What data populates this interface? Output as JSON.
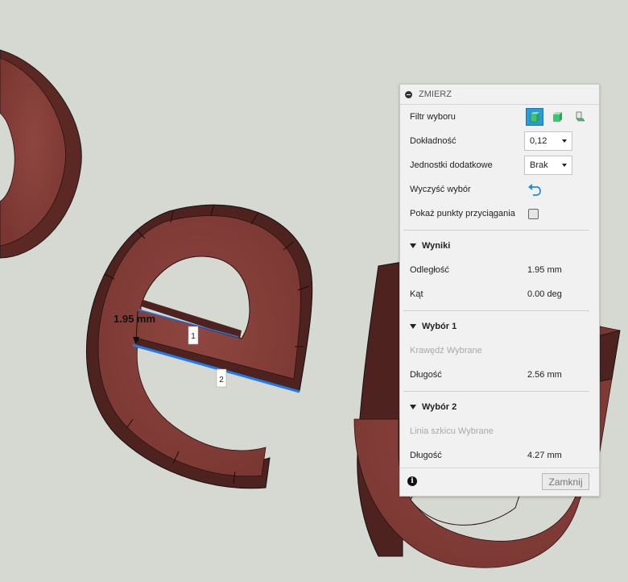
{
  "viewport": {
    "dimension_label": "1.95 mm",
    "edge_1_label": "1",
    "edge_2_label": "2",
    "model_color": "#8a413b",
    "highlight_color": "#1e7cf0"
  },
  "panel": {
    "title": "ZMIERZ",
    "selection_filter_label": "Filtr wyboru",
    "precision_label": "Dokładność",
    "precision_value": "0,12",
    "secondary_units_label": "Jednostki dodatkowe",
    "secondary_units_value": "Brak",
    "clear_selection_label": "Wyczyść wybór",
    "show_snap_points_label": "Pokaż punkty przyciągania",
    "results": {
      "title": "Wyniki",
      "distance_label": "Odległość",
      "distance_value": "1.95 mm",
      "angle_label": "Kąt",
      "angle_value": "0.00 deg"
    },
    "selection1": {
      "title": "Wybór 1",
      "status": "Krawędź Wybrane",
      "length_label": "Długość",
      "length_value": "2.56 mm"
    },
    "selection2": {
      "title": "Wybór 2",
      "status": "Linia szkicu Wybrane",
      "length_label": "Długość",
      "length_value": "4.27 mm"
    },
    "close_label": "Zamknij"
  }
}
